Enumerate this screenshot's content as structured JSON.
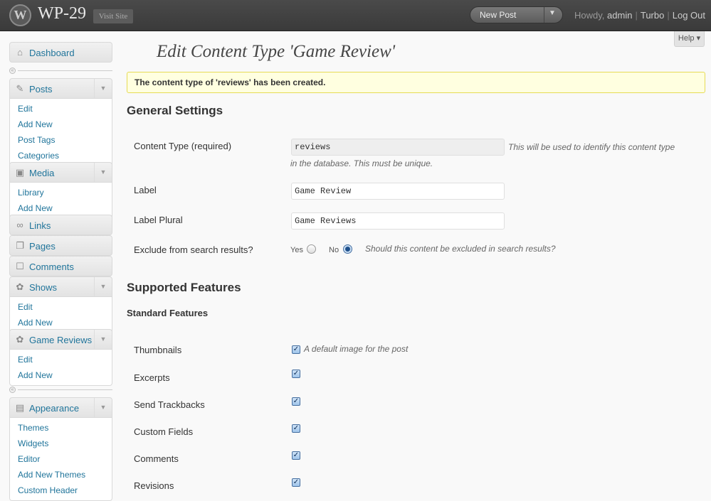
{
  "header": {
    "logo_letter": "W",
    "site_title": "WP-29",
    "visit_site": "Visit Site",
    "new_post": "New Post",
    "howdy": "Howdy,",
    "user": "admin",
    "link_turbo": "Turbo",
    "link_logout": "Log Out",
    "help": "Help"
  },
  "sidebar": {
    "dashboard": "Dashboard",
    "posts": {
      "label": "Posts",
      "items": [
        "Edit",
        "Add New",
        "Post Tags",
        "Categories"
      ]
    },
    "media": {
      "label": "Media",
      "items": [
        "Library",
        "Add New"
      ]
    },
    "links": "Links",
    "pages": "Pages",
    "comments": "Comments",
    "shows": {
      "label": "Shows",
      "items": [
        "Edit",
        "Add New"
      ]
    },
    "game_reviews": {
      "label": "Game Reviews",
      "items": [
        "Edit",
        "Add New"
      ]
    },
    "appearance": {
      "label": "Appearance",
      "items": [
        "Themes",
        "Widgets",
        "Editor",
        "Add New Themes",
        "Custom Header"
      ]
    }
  },
  "main": {
    "title": "Edit Content Type 'Game Review'",
    "notice": "The content type of 'reviews' has been created.",
    "general_heading": "General Settings",
    "content_type_label": "Content Type (required)",
    "content_type_value": "reviews",
    "content_type_desc_1": "This will be used to identify this content type",
    "content_type_desc_2": "in the database. This must be unique.",
    "label_label": "Label",
    "label_value": "Game Review",
    "label_plural_label": "Label Plural",
    "label_plural_value": "Game Reviews",
    "exclude_label": "Exclude from search results?",
    "exclude_yes": "Yes",
    "exclude_no": "No",
    "exclude_selected": "No",
    "exclude_desc": "Should this content be excluded in search results?",
    "supported_heading": "Supported Features",
    "standard_heading": "Standard Features",
    "features": [
      {
        "label": "Thumbnails",
        "checked": true,
        "desc": "A default image for the post"
      },
      {
        "label": "Excerpts",
        "checked": true,
        "desc": ""
      },
      {
        "label": "Send Trackbacks",
        "checked": true,
        "desc": ""
      },
      {
        "label": "Custom Fields",
        "checked": true,
        "desc": ""
      },
      {
        "label": "Comments",
        "checked": true,
        "desc": ""
      },
      {
        "label": "Revisions",
        "checked": true,
        "desc": ""
      }
    ]
  },
  "icons": {
    "dashboard": "home-icon",
    "posts": "pushpin-icon",
    "media": "media-icon",
    "links": "chain-link-icon",
    "pages": "pages-icon",
    "comments": "speech-bubble-icon",
    "shows": "gear-icon",
    "game_reviews": "gear-icon",
    "appearance": "appearance-icon"
  },
  "colors": {
    "header_bg": "#464646",
    "link": "#21759b",
    "notice_bg": "#ffffe0",
    "notice_border": "#e6db55"
  }
}
